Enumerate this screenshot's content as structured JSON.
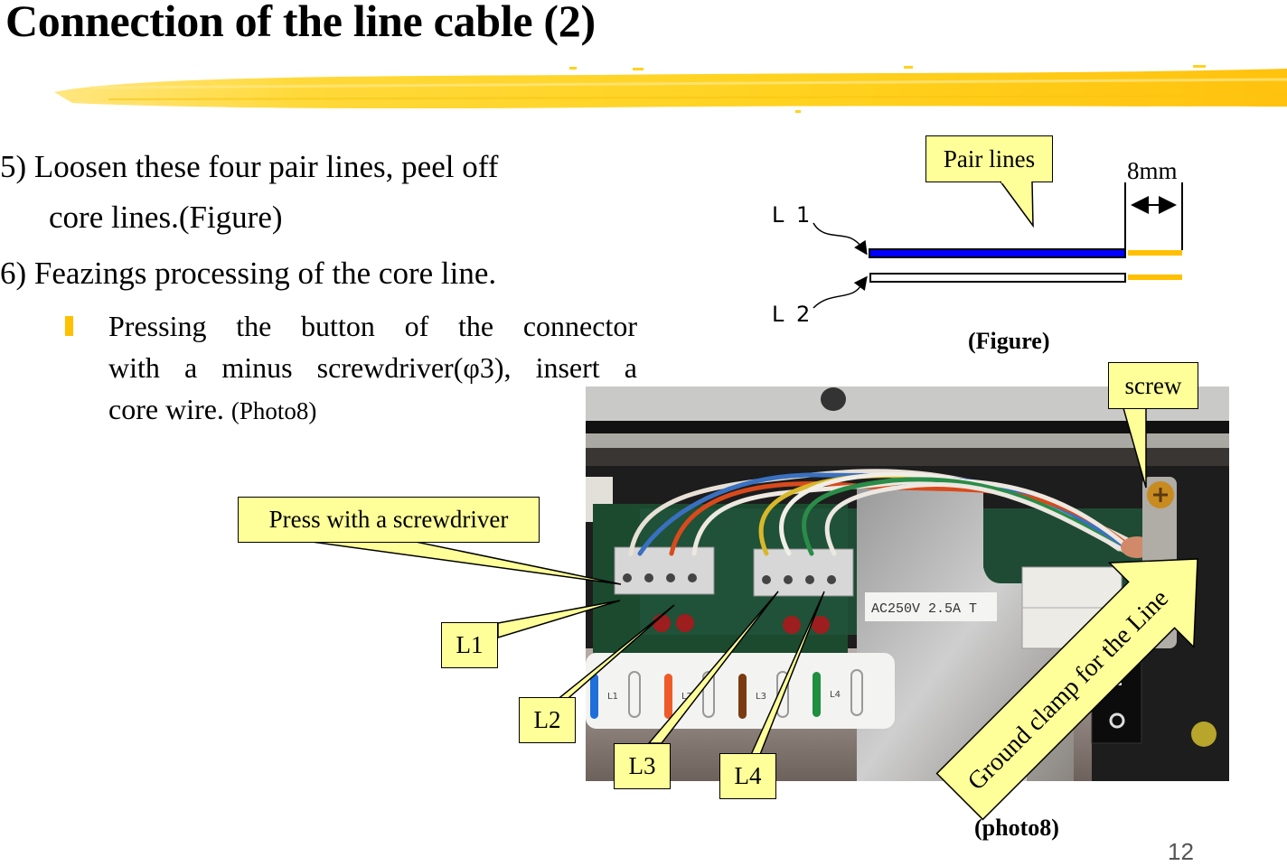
{
  "slide": {
    "title": "Connection of the line cable (2)",
    "page_number": "12"
  },
  "steps": {
    "step5_line1": "5) Loosen these four pair lines, peel off",
    "step5_line2": "core lines.(Figure)",
    "step6": "6) Feazings processing of the core line.",
    "bullet_line1": "Pressing the button of the connector",
    "bullet_line2": "with a minus screwdriver(φ3), insert a",
    "bullet_line3_main": "core wire.",
    "bullet_line3_ref": "(Photo8)"
  },
  "figure": {
    "callout": "Pair lines",
    "dimension": "8mm",
    "label_l1": "L 1",
    "label_l2": "L 2",
    "caption": "(Figure)",
    "colors": {
      "l1_wire": "#0000FF",
      "l2_wire": "#FFFFFF",
      "core": "#FFC000"
    }
  },
  "photo": {
    "caption": "(photo8)",
    "fuse_label": "AC250V 2.5A T",
    "sticker_labels": [
      "L1",
      "L2",
      "L3",
      "L4"
    ],
    "sticker_colors": [
      "#1E6FD9",
      "#F05A28",
      "#7A3B12",
      "#1E8F3E"
    ],
    "callouts": {
      "press": "Press with a screwdriver",
      "l1": "L1",
      "l2": "L2",
      "l3": "L3",
      "l4": "L4",
      "screw": "screw",
      "ground": "Ground clamp for the Line"
    }
  },
  "theme": {
    "callout_fill": "#FFFF99",
    "bullet_color": "#FFC000",
    "brush_color": "#FFD21F"
  }
}
